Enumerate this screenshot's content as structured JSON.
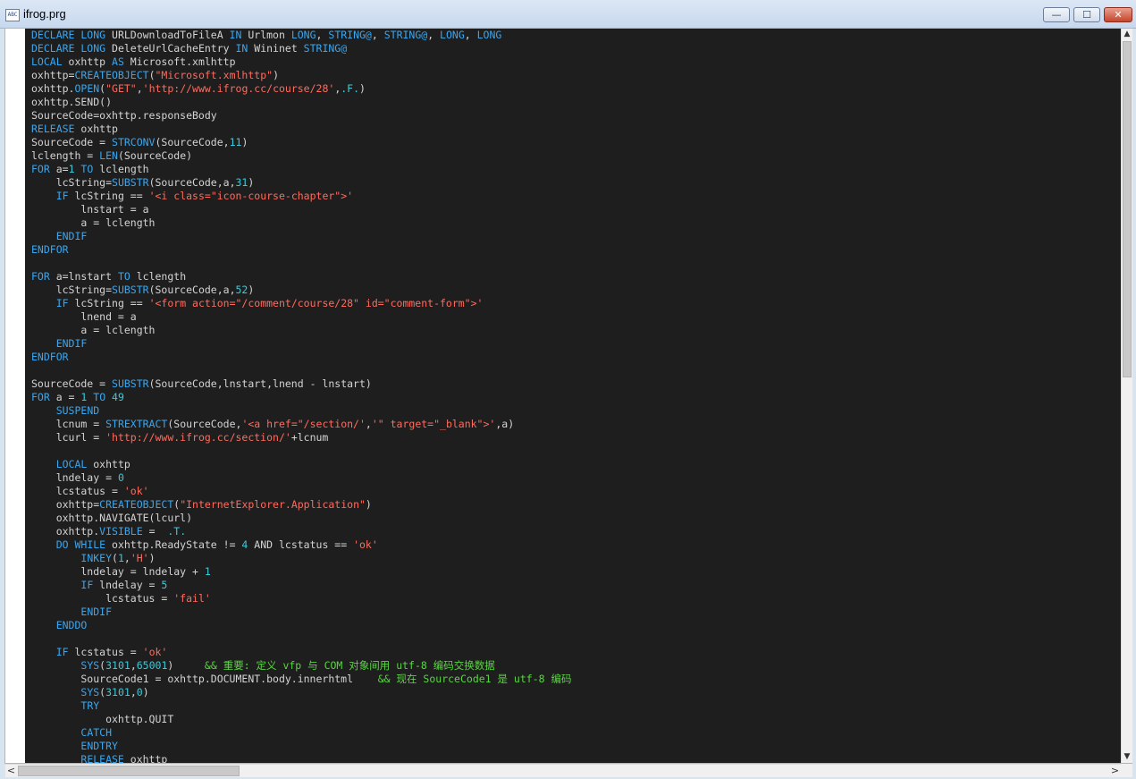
{
  "window": {
    "title": "ifrog.prg",
    "app_icon": "ABC",
    "buttons": {
      "minimize": "—",
      "maximize": "☐",
      "close": "✕"
    }
  },
  "colors": {
    "keyword": "#3aa6ee",
    "string": "#ff6b5e",
    "number": "#3cc9d9",
    "comment": "#5ad542",
    "text": "#d4d4d4",
    "background": "#1e1e1e"
  },
  "scrollbars": {
    "up_arrow": "▲",
    "down_arrow": "▼",
    "left_arrow": "<",
    "right_arrow": ">"
  },
  "code_lines": [
    [
      [
        "k",
        "DECLARE LONG "
      ],
      [
        "t",
        "URLDownloadToFileA "
      ],
      [
        "k",
        "IN "
      ],
      [
        "t",
        "Urlmon "
      ],
      [
        "k",
        "LONG"
      ],
      [
        "t",
        ", "
      ],
      [
        "k",
        "STRING@"
      ],
      [
        "t",
        ", "
      ],
      [
        "k",
        "STRING@"
      ],
      [
        "t",
        ", "
      ],
      [
        "k",
        "LONG"
      ],
      [
        "t",
        ", "
      ],
      [
        "k",
        "LONG"
      ]
    ],
    [
      [
        "k",
        "DECLARE LONG "
      ],
      [
        "t",
        "DeleteUrlCacheEntry "
      ],
      [
        "k",
        "IN "
      ],
      [
        "t",
        "Wininet "
      ],
      [
        "k",
        "STRING@"
      ]
    ],
    [
      [
        "k",
        "LOCAL "
      ],
      [
        "t",
        "oxhttp "
      ],
      [
        "k",
        "AS "
      ],
      [
        "t",
        "Microsoft.xmlhttp"
      ]
    ],
    [
      [
        "t",
        "oxhttp="
      ],
      [
        "k",
        "CREATEOBJECT"
      ],
      [
        "t",
        "("
      ],
      [
        "s",
        "\"Microsoft.xmlhttp\""
      ],
      [
        "t",
        ")"
      ]
    ],
    [
      [
        "t",
        "oxhttp."
      ],
      [
        "k",
        "OPEN"
      ],
      [
        "t",
        "("
      ],
      [
        "s",
        "\"GET\""
      ],
      [
        "t",
        ","
      ],
      [
        "s",
        "'http://www.ifrog.cc/course/28'"
      ],
      [
        "t",
        ","
      ],
      [
        "n",
        ".F."
      ],
      [
        "t",
        ")"
      ]
    ],
    [
      [
        "t",
        "oxhttp.SEND()"
      ]
    ],
    [
      [
        "t",
        "SourceCode=oxhttp.responseBody"
      ]
    ],
    [
      [
        "k",
        "RELEASE "
      ],
      [
        "t",
        "oxhttp"
      ]
    ],
    [
      [
        "t",
        "SourceCode = "
      ],
      [
        "k",
        "STRCONV"
      ],
      [
        "t",
        "(SourceCode,"
      ],
      [
        "n",
        "11"
      ],
      [
        "t",
        ")"
      ]
    ],
    [
      [
        "t",
        "lclength = "
      ],
      [
        "k",
        "LEN"
      ],
      [
        "t",
        "(SourceCode)"
      ]
    ],
    [
      [
        "k",
        "FOR "
      ],
      [
        "t",
        "a="
      ],
      [
        "n",
        "1"
      ],
      [
        "k",
        " TO "
      ],
      [
        "t",
        "lclength"
      ]
    ],
    [
      [
        "t",
        "    lcString="
      ],
      [
        "k",
        "SUBSTR"
      ],
      [
        "t",
        "(SourceCode,a,"
      ],
      [
        "n",
        "31"
      ],
      [
        "t",
        ")"
      ]
    ],
    [
      [
        "t",
        "    "
      ],
      [
        "k",
        "IF "
      ],
      [
        "t",
        "lcString == "
      ],
      [
        "s",
        "'<i class=\"icon-course-chapter\">'"
      ]
    ],
    [
      [
        "t",
        "        lnstart = a"
      ]
    ],
    [
      [
        "t",
        "        a = lclength"
      ]
    ],
    [
      [
        "t",
        "    "
      ],
      [
        "k",
        "ENDIF"
      ]
    ],
    [
      [
        "k",
        "ENDFOR"
      ]
    ],
    [
      [
        "t",
        ""
      ]
    ],
    [
      [
        "k",
        "FOR "
      ],
      [
        "t",
        "a=lnstart "
      ],
      [
        "k",
        "TO "
      ],
      [
        "t",
        "lclength"
      ]
    ],
    [
      [
        "t",
        "    lcString="
      ],
      [
        "k",
        "SUBSTR"
      ],
      [
        "t",
        "(SourceCode,a,"
      ],
      [
        "n",
        "52"
      ],
      [
        "t",
        ")"
      ]
    ],
    [
      [
        "t",
        "    "
      ],
      [
        "k",
        "IF "
      ],
      [
        "t",
        "lcString == "
      ],
      [
        "s",
        "'<form action=\"/comment/course/28\" id=\"comment-form\">'"
      ]
    ],
    [
      [
        "t",
        "        lnend = a"
      ]
    ],
    [
      [
        "t",
        "        a = lclength"
      ]
    ],
    [
      [
        "t",
        "    "
      ],
      [
        "k",
        "ENDIF"
      ]
    ],
    [
      [
        "k",
        "ENDFOR"
      ]
    ],
    [
      [
        "t",
        ""
      ]
    ],
    [
      [
        "t",
        "SourceCode = "
      ],
      [
        "k",
        "SUBSTR"
      ],
      [
        "t",
        "(SourceCode,lnstart,lnend - lnstart)"
      ]
    ],
    [
      [
        "k",
        "FOR "
      ],
      [
        "t",
        "a = "
      ],
      [
        "n",
        "1"
      ],
      [
        "k",
        " TO "
      ],
      [
        "n",
        "49"
      ]
    ],
    [
      [
        "t",
        "    "
      ],
      [
        "k",
        "SUSPEND"
      ]
    ],
    [
      [
        "t",
        "    lcnum = "
      ],
      [
        "k",
        "STREXTRACT"
      ],
      [
        "t",
        "(SourceCode,"
      ],
      [
        "s",
        "'<a href=\"/section/'"
      ],
      [
        "t",
        ","
      ],
      [
        "s",
        "'\" target=\"_blank\">'"
      ],
      [
        "t",
        ",a)"
      ]
    ],
    [
      [
        "t",
        "    lcurl = "
      ],
      [
        "s",
        "'http://www.ifrog.cc/section/'"
      ],
      [
        "t",
        "+lcnum"
      ]
    ],
    [
      [
        "t",
        ""
      ]
    ],
    [
      [
        "t",
        "    "
      ],
      [
        "k",
        "LOCAL "
      ],
      [
        "t",
        "oxhttp"
      ]
    ],
    [
      [
        "t",
        "    lndelay = "
      ],
      [
        "n",
        "0"
      ]
    ],
    [
      [
        "t",
        "    lcstatus = "
      ],
      [
        "s",
        "'ok'"
      ]
    ],
    [
      [
        "t",
        "    oxhttp="
      ],
      [
        "k",
        "CREATEOBJECT"
      ],
      [
        "t",
        "("
      ],
      [
        "s",
        "\"InternetExplorer.Application\""
      ],
      [
        "t",
        ")"
      ]
    ],
    [
      [
        "t",
        "    oxhttp.NAVIGATE(lcurl)"
      ]
    ],
    [
      [
        "t",
        "    oxhttp."
      ],
      [
        "k",
        "VISIBLE"
      ],
      [
        "t",
        " =  "
      ],
      [
        "n",
        ".T."
      ]
    ],
    [
      [
        "t",
        "    "
      ],
      [
        "k",
        "DO WHILE "
      ],
      [
        "t",
        "oxhttp.ReadyState != "
      ],
      [
        "n",
        "4"
      ],
      [
        "t",
        " AND lcstatus == "
      ],
      [
        "s",
        "'ok'"
      ]
    ],
    [
      [
        "t",
        "        "
      ],
      [
        "k",
        "INKEY"
      ],
      [
        "t",
        "("
      ],
      [
        "n",
        "1"
      ],
      [
        "t",
        ","
      ],
      [
        "s",
        "'H'"
      ],
      [
        "t",
        ")"
      ]
    ],
    [
      [
        "t",
        "        lndelay = lndelay + "
      ],
      [
        "n",
        "1"
      ]
    ],
    [
      [
        "t",
        "        "
      ],
      [
        "k",
        "IF "
      ],
      [
        "t",
        "lndelay = "
      ],
      [
        "n",
        "5"
      ]
    ],
    [
      [
        "t",
        "            lcstatus = "
      ],
      [
        "s",
        "'fail'"
      ]
    ],
    [
      [
        "t",
        "        "
      ],
      [
        "k",
        "ENDIF"
      ]
    ],
    [
      [
        "t",
        "    "
      ],
      [
        "k",
        "ENDDO"
      ]
    ],
    [
      [
        "t",
        ""
      ]
    ],
    [
      [
        "t",
        "    "
      ],
      [
        "k",
        "IF "
      ],
      [
        "t",
        "lcstatus = "
      ],
      [
        "s",
        "'ok'"
      ]
    ],
    [
      [
        "t",
        "        "
      ],
      [
        "k",
        "SYS"
      ],
      [
        "t",
        "("
      ],
      [
        "n",
        "3101"
      ],
      [
        "t",
        ","
      ],
      [
        "n",
        "65001"
      ],
      [
        "t",
        ")     "
      ],
      [
        "c",
        "&& 重要: 定义 vfp 与 COM 对象间用 utf-8 编码交换数据"
      ]
    ],
    [
      [
        "t",
        "        SourceCode1 = oxhttp.DOCUMENT.body.innerhtml    "
      ],
      [
        "c",
        "&& 现在 SourceCode1 是 utf-8 编码"
      ]
    ],
    [
      [
        "t",
        "        "
      ],
      [
        "k",
        "SYS"
      ],
      [
        "t",
        "("
      ],
      [
        "n",
        "3101"
      ],
      [
        "t",
        ","
      ],
      [
        "n",
        "0"
      ],
      [
        "t",
        ")"
      ]
    ],
    [
      [
        "t",
        "        "
      ],
      [
        "k",
        "TRY"
      ]
    ],
    [
      [
        "t",
        "            oxhttp.QUIT"
      ]
    ],
    [
      [
        "t",
        "        "
      ],
      [
        "k",
        "CATCH"
      ]
    ],
    [
      [
        "t",
        "        "
      ],
      [
        "k",
        "ENDTRY"
      ]
    ],
    [
      [
        "t",
        "        "
      ],
      [
        "k",
        "RELEASE "
      ],
      [
        "t",
        "oxhttp"
      ]
    ]
  ]
}
